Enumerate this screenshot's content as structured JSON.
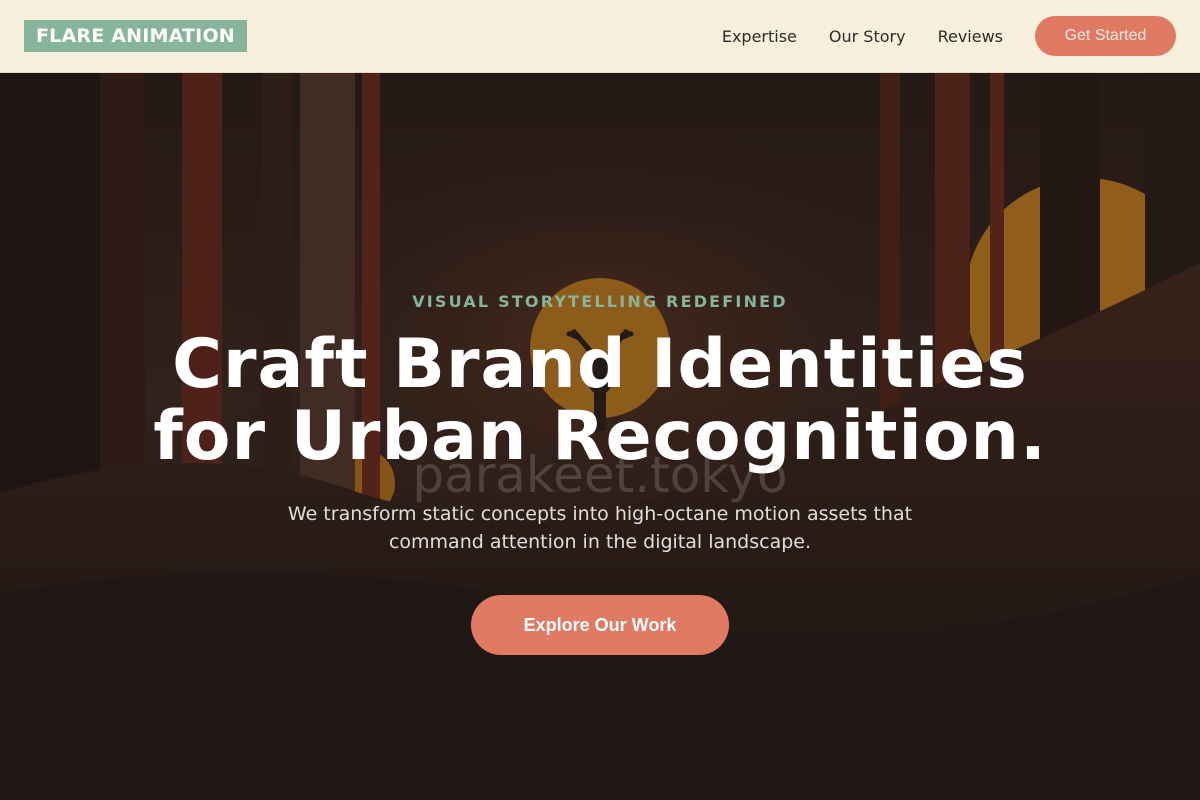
{
  "nav": {
    "logo": "FLARE ANIMATION",
    "links": [
      "Expertise",
      "Our Story",
      "Reviews"
    ],
    "cta": "Get Started"
  },
  "hero": {
    "eyebrow": "VISUAL STORYTELLING REDEFINED",
    "headline_line1": "Craft Brand Identities",
    "headline_line2": "for Urban Recognition.",
    "watermark": "parakeet.tokyo",
    "subhead_line1": "We transform static concepts into high-octane motion assets that",
    "subhead_line2": "command attention in the digital landscape.",
    "cta": "Explore Our Work"
  },
  "colors": {
    "nav_background": "#f5efdc",
    "logo_background": "#86b59b",
    "accent": "#e07a63",
    "eyebrow": "#86b59b",
    "hero_text": "#ffffff"
  }
}
